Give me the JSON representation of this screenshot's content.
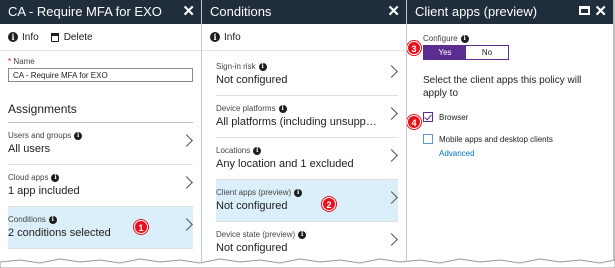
{
  "blade1": {
    "title": "CA - Require MFA for EXO",
    "commands": {
      "info": "Info",
      "delete": "Delete"
    },
    "name_label": "Name",
    "name_value": "CA - Require MFA for EXO",
    "assignments_heading": "Assignments",
    "items": [
      {
        "label": "Users and groups",
        "value": "All users"
      },
      {
        "label": "Cloud apps",
        "value": "1 app included"
      },
      {
        "label": "Conditions",
        "value": "2 conditions selected",
        "badge": "1"
      }
    ]
  },
  "blade2": {
    "title": "Conditions",
    "commands": {
      "info": "Info"
    },
    "items": [
      {
        "label": "Sign-in risk",
        "value": "Not configured"
      },
      {
        "label": "Device platforms",
        "value": "All platforms (including unsuppo..."
      },
      {
        "label": "Locations",
        "value": "Any location and 1 excluded"
      },
      {
        "label": "Client apps (preview)",
        "value": "Not configured",
        "badge": "2"
      },
      {
        "label": "Device state (preview)",
        "value": "Not configured"
      }
    ]
  },
  "blade3": {
    "title": "Client apps (preview)",
    "configure_label": "Configure",
    "toggle": {
      "yes": "Yes",
      "no": "No",
      "selected": "Yes"
    },
    "badge3": "3",
    "description": "Select the client apps this policy will apply to",
    "badge4": "4",
    "options": [
      {
        "label": "Browser",
        "checked": true
      },
      {
        "label": "Mobile apps and desktop clients",
        "checked": false
      }
    ],
    "advanced_link": "Advanced"
  },
  "colors": {
    "titlebar": "#1f2d3d",
    "accent": "#5c2d91",
    "link": "#0072c6",
    "badge": "#e8101b",
    "active": "#dbeffb"
  }
}
